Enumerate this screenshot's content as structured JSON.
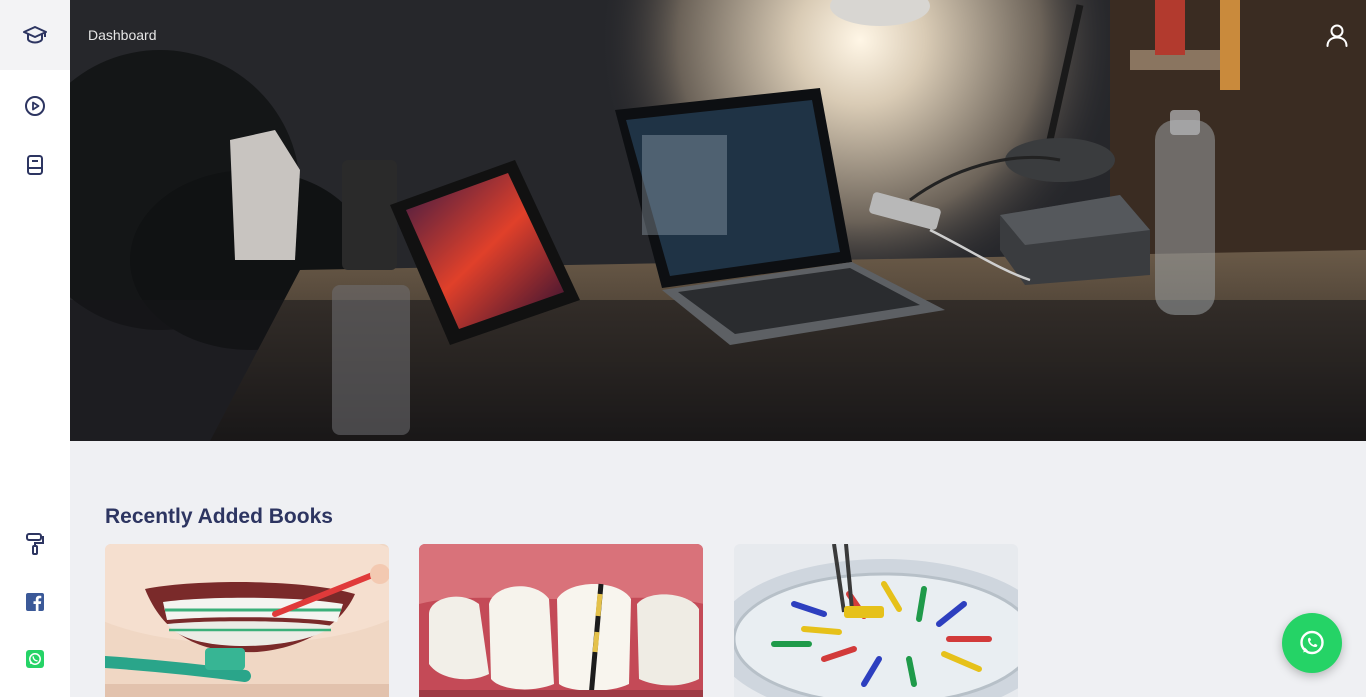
{
  "header": {
    "breadcrumb": "Dashboard"
  },
  "sidebar": {
    "logo_icon": "graduation-cap-icon",
    "items": [
      {
        "icon": "play-circle-icon"
      },
      {
        "icon": "book-icon"
      }
    ],
    "bottom_items": [
      {
        "icon": "paint-roller-icon"
      },
      {
        "icon": "facebook-icon",
        "color": "#3b5998"
      },
      {
        "icon": "whatsapp-icon",
        "color": "#25d366"
      }
    ]
  },
  "section": {
    "title": "Recently Added Books"
  },
  "books": [
    {
      "image": "braces-toothbrush-image"
    },
    {
      "image": "teeth-periodontal-probe-image"
    },
    {
      "image": "endodontic-files-dish-image"
    }
  ],
  "colors": {
    "accent": "#2d3561",
    "whatsapp": "#25d366",
    "background": "#eff0f3"
  }
}
